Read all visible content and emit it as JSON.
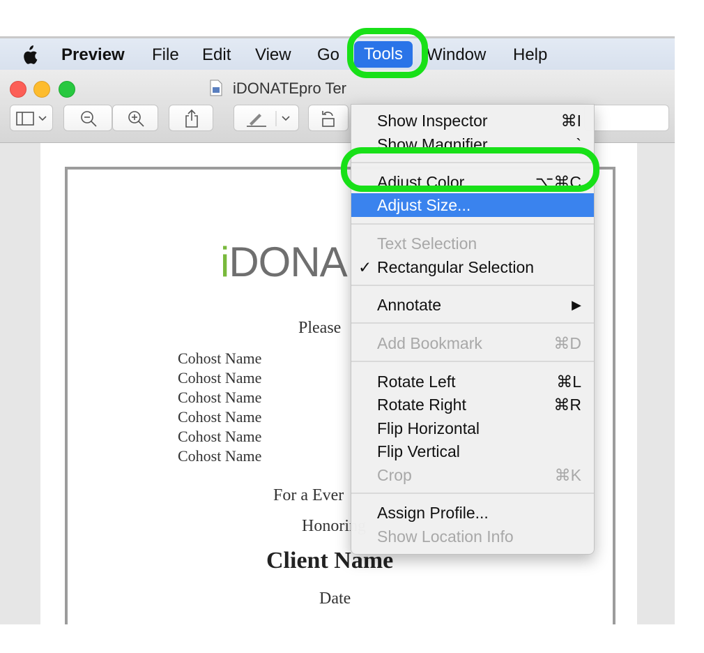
{
  "menubar": {
    "app_name": "Preview",
    "items": [
      "File",
      "Edit",
      "View",
      "Go",
      "Tools",
      "Window",
      "Help"
    ]
  },
  "window": {
    "title": "iDONATEpro Ter"
  },
  "document": {
    "logo_i": "i",
    "logo_rest": "DONA",
    "please_text": "Please",
    "cohosts": [
      "Cohost Name",
      "Cohost Name",
      "Cohost Name",
      "Cohost Name",
      "Cohost Name",
      "Cohost Name"
    ],
    "for_event": "For a Ever",
    "honoring": "Honoring",
    "client_name": "Client Name",
    "date": "Date"
  },
  "tools_menu": {
    "show_inspector": {
      "label": "Show Inspector",
      "shortcut": "⌘I"
    },
    "show_magnifier": {
      "label": "Show Magnifier",
      "shortcut": "`"
    },
    "adjust_color": {
      "label": "Adjust Color...",
      "shortcut": "⌥⌘C"
    },
    "adjust_size": {
      "label": "Adjust Size..."
    },
    "text_selection": {
      "label": "Text Selection"
    },
    "rectangular_selection": {
      "label": "Rectangular Selection",
      "check": "✓"
    },
    "annotate": {
      "label": "Annotate",
      "arrow": "▶"
    },
    "add_bookmark": {
      "label": "Add Bookmark",
      "shortcut": "⌘D"
    },
    "rotate_left": {
      "label": "Rotate Left",
      "shortcut": "⌘L"
    },
    "rotate_right": {
      "label": "Rotate Right",
      "shortcut": "⌘R"
    },
    "flip_horizontal": {
      "label": "Flip Horizontal"
    },
    "flip_vertical": {
      "label": "Flip Vertical"
    },
    "crop": {
      "label": "Crop",
      "shortcut": "⌘K"
    },
    "assign_profile": {
      "label": "Assign Profile..."
    },
    "show_location_info": {
      "label": "Show Location Info"
    }
  },
  "colors": {
    "highlight_ring": "#18e018",
    "menu_selection": "#3a83ee",
    "logo_green": "#79b93c"
  }
}
